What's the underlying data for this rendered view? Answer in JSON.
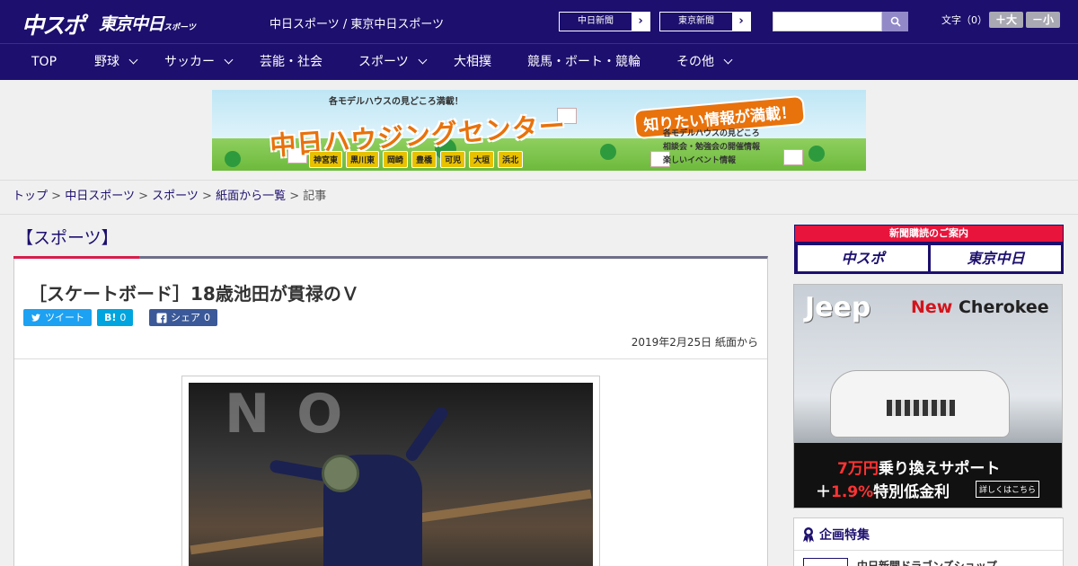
{
  "header": {
    "logo_chuspo": "中スポ",
    "logo_tokyo": "東京中日",
    "logo_tokyo_small": "スポーツ",
    "site_title": "中日スポーツ / 東京中日スポーツ",
    "newspaper_links": [
      "中日新聞",
      "東京新聞"
    ],
    "fontsize_label": "文字（0）",
    "fontsize_up": "＋大",
    "fontsize_down": "－小"
  },
  "nav": {
    "items": [
      {
        "label": "TOP",
        "dropdown": false
      },
      {
        "label": "野球",
        "dropdown": true
      },
      {
        "label": "サッカー",
        "dropdown": true
      },
      {
        "label": "芸能・社会",
        "dropdown": false
      },
      {
        "label": "スポーツ",
        "dropdown": true
      },
      {
        "label": "大相撲",
        "dropdown": false
      },
      {
        "label": "競馬・ボート・競輪",
        "dropdown": false
      },
      {
        "label": "その他",
        "dropdown": true
      }
    ]
  },
  "ad_banner": {
    "top_text": "各モデルハウスの見どころ満載！",
    "title": "中日ハウジングセンター",
    "tag": "知りたい情報が満載！",
    "items": [
      "各モデルハウスの見どころ",
      "相談会・勉強会の開催情報",
      "楽しいイベント情報"
    ],
    "cities": [
      "神宮東",
      "黒川東",
      "岡崎",
      "豊橋",
      "可児",
      "大垣",
      "浜北"
    ]
  },
  "breadcrumb": {
    "items": [
      "トップ",
      "中日スポーツ",
      "スポーツ",
      "紙面から一覧"
    ],
    "current": "記事",
    "separator": ">"
  },
  "article": {
    "category": "【スポーツ】",
    "headline": "［スケートボード］18歳池田が貫禄のＶ",
    "share_tweet": "ツイート",
    "share_hatena": "B!",
    "share_hatena_count": "0",
    "share_fb": "シェア",
    "share_fb_count": "0",
    "date": "2019年2月25日 紙面から"
  },
  "sidebar": {
    "subscription_head": "新聞購読のご案内",
    "subscription_logos": [
      "中スポ",
      "東京中日"
    ],
    "jeep_ad": {
      "brand": "Jeep",
      "model_new": "New",
      "model_name": "Cherokee",
      "line1_red": "7万円",
      "line1_rest": "乗り換えサポート",
      "line2_prefix": "＋",
      "line2_red": "1.9%",
      "line2_rest": "特別低金利",
      "detail": "詳しくはこちら"
    },
    "feature_title": "企画特集",
    "feature_item": "中日新聞ドラゴンズショップ"
  },
  "colors": {
    "primary": "#1c0f6e",
    "accent_red": "#d61e4c",
    "twitter": "#1da1f2",
    "hatena": "#00a4de",
    "facebook": "#3b5998"
  }
}
